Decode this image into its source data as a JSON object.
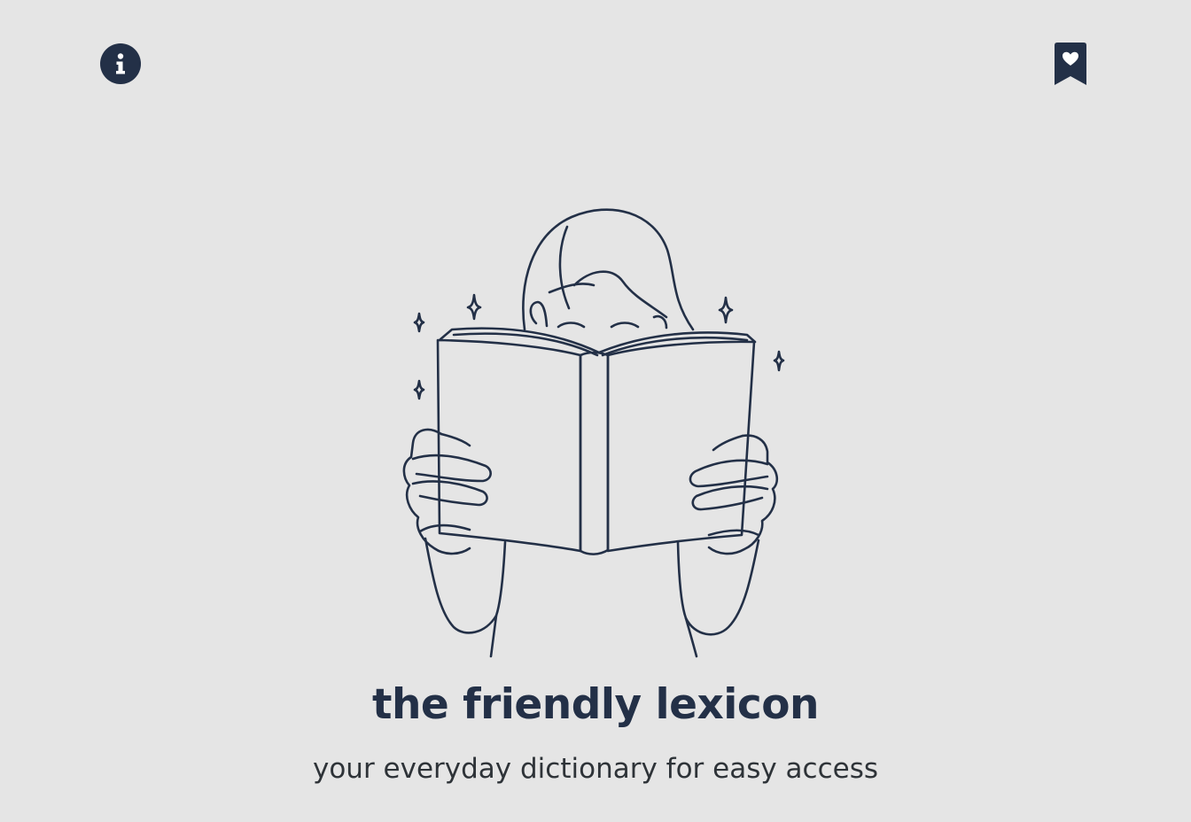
{
  "header": {
    "info_icon": "info-icon",
    "bookmark_icon": "bookmark-heart-icon"
  },
  "hero": {
    "illustration": "person-reading-book-illustration",
    "title": "the friendly lexicon",
    "subtitle": "your everyday dictionary for easy access"
  },
  "colors": {
    "background": "#e5e5e5",
    "primary": "#233047",
    "text": "#2e3338"
  }
}
